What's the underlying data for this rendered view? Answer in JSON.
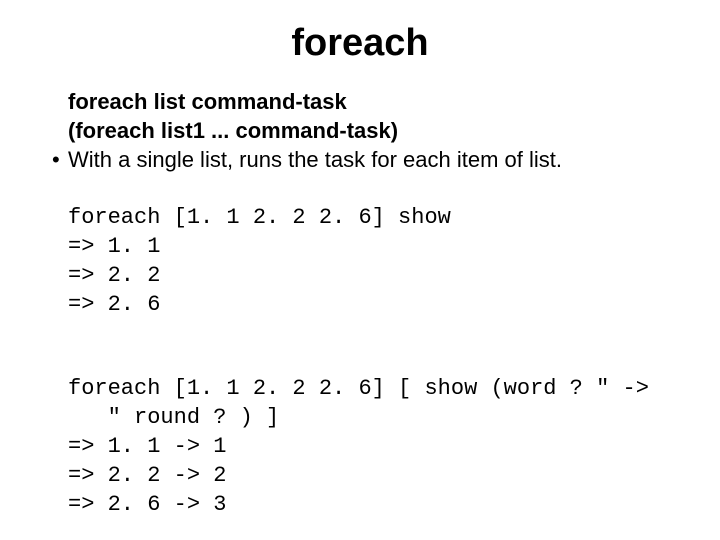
{
  "title": "foreach",
  "signature1": "foreach list command-task",
  "signature2": "(foreach list1 ... command-task)",
  "bullet": "With a single list, runs the task for each item of list.",
  "code1_l1": "foreach [1. 1 2. 2 2. 6] show",
  "code1_l2": "=> 1. 1",
  "code1_l3": "=> 2. 2",
  "code1_l4": "=> 2. 6",
  "code2_l1": "foreach [1. 1 2. 2 2. 6] [ show (word ? \" ->",
  "code2_l2": "   \" round ? ) ]",
  "code2_l3": "=> 1. 1 -> 1",
  "code2_l4": "=> 2. 2 -> 2",
  "code2_l5": "=> 2. 6 -> 3"
}
